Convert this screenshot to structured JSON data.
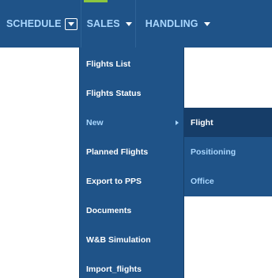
{
  "navbar": {
    "items": [
      {
        "label": "SCHEDULE"
      },
      {
        "label": "SALES"
      },
      {
        "label": "HANDLING"
      }
    ]
  },
  "dropdown": {
    "items": [
      {
        "label": "Flights List"
      },
      {
        "label": "Flights Status"
      },
      {
        "label": "New"
      },
      {
        "label": "Planned Flights"
      },
      {
        "label": "Export to PPS"
      },
      {
        "label": "Documents"
      },
      {
        "label": "W&B Simulation"
      },
      {
        "label": "Import_flights"
      }
    ]
  },
  "submenu": {
    "items": [
      {
        "label": "Flight"
      },
      {
        "label": "Positioning"
      },
      {
        "label": "Office"
      }
    ]
  },
  "colors": {
    "menu_background": "#1f5388",
    "active_indicator": "#8cc63f",
    "highlight_text": "#a9d7ff",
    "selected_background": "#163d68"
  }
}
